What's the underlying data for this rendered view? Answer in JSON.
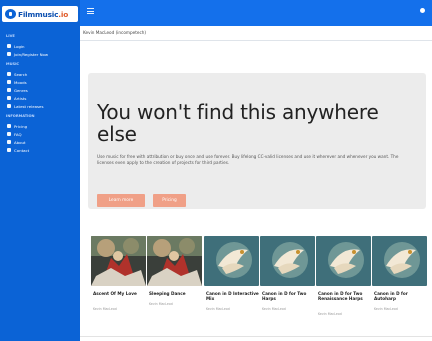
{
  "app": {
    "logo_text": "Filmmusic",
    "logo_accent": ".io"
  },
  "colors": {
    "sidebar": "#0b63d6",
    "topbar": "#1470eb",
    "hero_background": "#ececec",
    "button": "#f0a087"
  },
  "sidebar": {
    "sections": [
      {
        "label": "LIVE"
      },
      {
        "label": "MUSIC"
      },
      {
        "label": "INFORMATION"
      }
    ],
    "items": [
      {
        "label": "Login",
        "icon": "login-icon"
      },
      {
        "label": "Join/Register Now",
        "icon": "user-plus-icon"
      },
      {
        "label": "Search",
        "icon": "search-icon"
      },
      {
        "label": "Moods",
        "icon": "mood-icon"
      },
      {
        "label": "Genres",
        "icon": "genre-icon"
      },
      {
        "label": "Artists",
        "icon": "artist-icon"
      },
      {
        "label": "Latest releases",
        "icon": "new-icon"
      },
      {
        "label": "Pricing",
        "icon": "price-icon"
      },
      {
        "label": "FAQ",
        "icon": "faq-icon"
      },
      {
        "label": "About",
        "icon": "info-icon"
      },
      {
        "label": "Contact",
        "icon": "mail-icon"
      }
    ]
  },
  "breadcrumb": "Kevin MacLeod (incompetech)",
  "hero": {
    "title": "You won't find this anywhere else",
    "body": "Use music for free with attribution or buy once and use forever. Buy lifelong CC-valid licenses and use it wherever and whenever you want. The licenses even apply to the creation of projects for third parties.",
    "learn_more": "Learn more",
    "pricing": "Pricing"
  },
  "tracks": [
    {
      "title": "Ascent Of My Love",
      "subtitle": "Kevin MacLeod",
      "artwork": "dancer-artwork"
    },
    {
      "title": "Sleeping Dance",
      "subtitle": "Kevin MacLeod",
      "artwork": "dancer-artwork"
    },
    {
      "title": "Canon in D Interactive Mix",
      "subtitle": "Kevin MacLeod",
      "artwork": "bird-artwork"
    },
    {
      "title": "Canon in D for Two Harps",
      "subtitle": "Kevin MacLeod",
      "artwork": "bird-artwork"
    },
    {
      "title": "Canon in D for Two Renaissance Harps",
      "subtitle": "Kevin MacLeod",
      "artwork": "bird-artwork"
    },
    {
      "title": "Canon in D for Autoharp",
      "subtitle": "Kevin MacLeod",
      "artwork": "bird-artwork"
    }
  ]
}
